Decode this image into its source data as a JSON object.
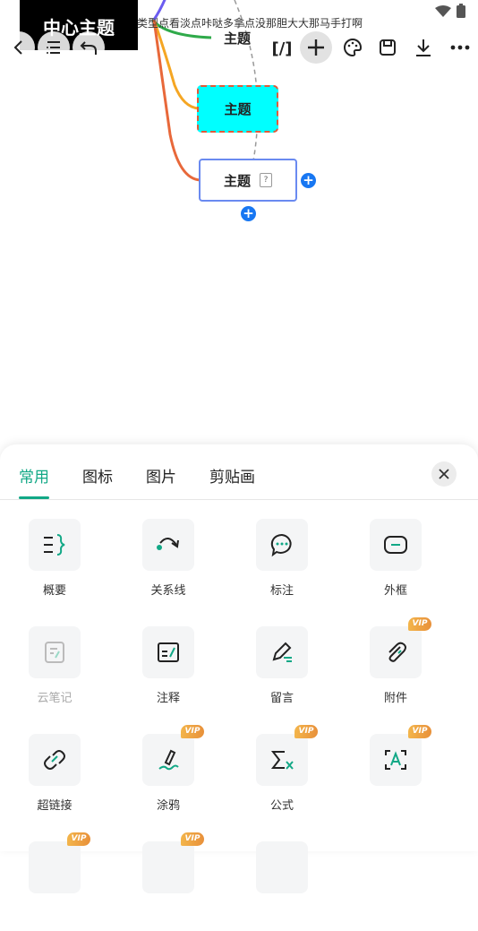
{
  "canvas": {
    "center_topic": "中心主题",
    "overlay_text": "类型点看淡点咔哒多拿点没那胆大大那马手打啊",
    "topics": [
      "主题",
      "主题",
      "主题"
    ],
    "colors": {
      "selected_fill": "#00ffff",
      "dashed_border": "#e05a3a",
      "selection_border": "#6a8af0",
      "add_button": "#1877f2"
    }
  },
  "toolbar": {
    "back_icon": "chevron-left-icon",
    "outline_icon": "list-icon",
    "undo_icon": "undo-icon",
    "format_label": "[/]",
    "add_icon": "plus-icon",
    "style_icon": "palette-icon",
    "save_icon": "save-icon",
    "export_icon": "download-icon",
    "more_icon": "more-icon"
  },
  "panel": {
    "tabs": [
      {
        "label": "常用",
        "active": true
      },
      {
        "label": "图标",
        "active": false
      },
      {
        "label": "图片",
        "active": false
      },
      {
        "label": "剪贴画",
        "active": false
      }
    ],
    "accent": "#12a886",
    "vip_badge": "VIP",
    "tools": [
      {
        "label": "概要",
        "icon": "summary-icon",
        "vip": false
      },
      {
        "label": "关系线",
        "icon": "relation-line-icon",
        "vip": false
      },
      {
        "label": "标注",
        "icon": "callout-icon",
        "vip": false
      },
      {
        "label": "外框",
        "icon": "boundary-icon",
        "vip": false
      },
      {
        "label": "云笔记",
        "icon": "cloud-note-icon",
        "vip": false
      },
      {
        "label": "注释",
        "icon": "annotation-icon",
        "vip": false
      },
      {
        "label": "留言",
        "icon": "comment-icon",
        "vip": false
      },
      {
        "label": "附件",
        "icon": "paperclip-icon",
        "vip": true
      },
      {
        "label": "超链接",
        "icon": "link-icon",
        "vip": false
      },
      {
        "label": "涂鸦",
        "icon": "doodle-icon",
        "vip": true
      },
      {
        "label": "公式",
        "icon": "formula-icon",
        "vip": true
      },
      {
        "label": "",
        "icon": "text-recognition-icon",
        "vip": true
      }
    ]
  }
}
